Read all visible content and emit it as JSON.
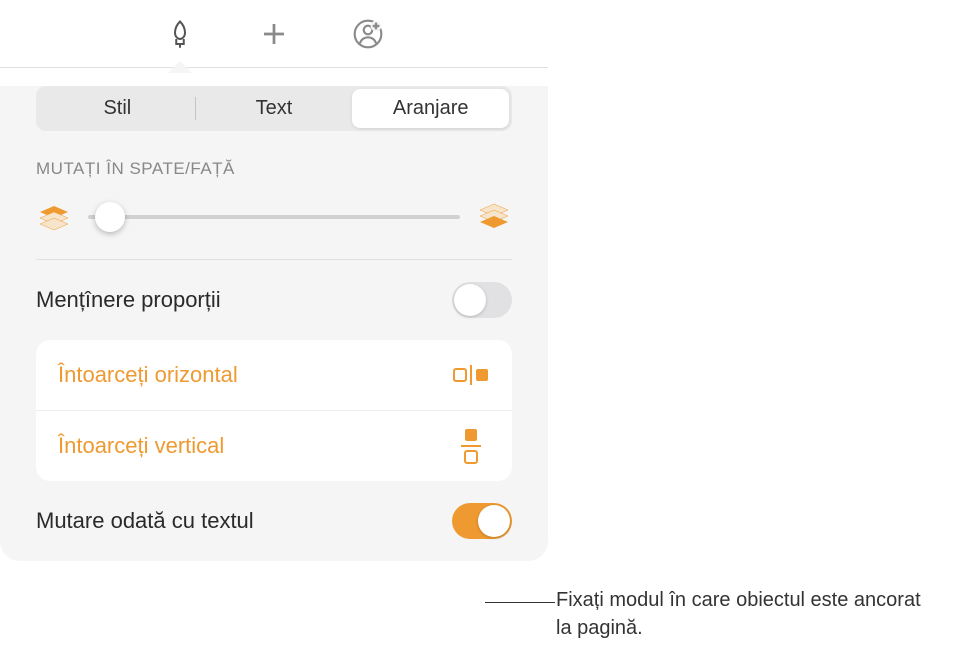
{
  "toolbar": {
    "icons": [
      "brush-icon",
      "plus-icon",
      "person-add-icon"
    ]
  },
  "tabs": {
    "items": [
      {
        "label": "Stil"
      },
      {
        "label": "Text"
      },
      {
        "label": "Aranjare"
      }
    ]
  },
  "layering": {
    "label": "MUTAȚI ÎN SPATE/FAȚĂ"
  },
  "proportions": {
    "label": "Mențînere proporții",
    "enabled": false
  },
  "flip": {
    "horizontal": "Întoarceți orizontal",
    "vertical": "Întoarceți vertical"
  },
  "move_with_text": {
    "label": "Mutare odată cu textul",
    "enabled": true
  },
  "annotation": {
    "text": "Fixați modul în care obiectul este ancorat la pagină."
  },
  "colors": {
    "accent": "#ee9a31"
  }
}
